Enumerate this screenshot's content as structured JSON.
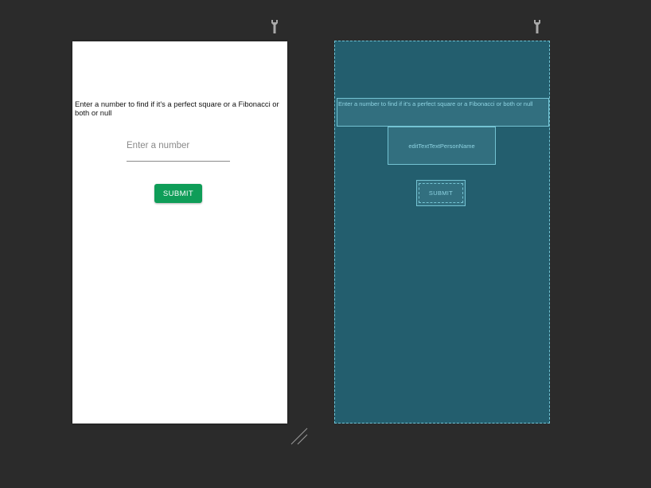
{
  "design": {
    "prompt_text": "Enter a number to find if it's a perfect square or a Fibonacci or both or null",
    "input_placeholder": "Enter a number",
    "submit_label": "SUBMIT"
  },
  "blueprint": {
    "prompt_text": "Enter a number to find if it's a perfect square or a Fibonacci or both or null",
    "input_id": "editTextTextPersonName",
    "submit_label": "SUBMIT"
  },
  "icons": {
    "design_toolbar": "wrench-icon",
    "blueprint_toolbar": "wrench-icon",
    "resize": "resize-handle-icon"
  },
  "colors": {
    "canvas_background": "#2b2b2b",
    "design_background": "#ffffff",
    "blueprint_background": "#235e6e",
    "blueprint_outline": "#74c3d3",
    "submit_button": "#0f9d58"
  }
}
